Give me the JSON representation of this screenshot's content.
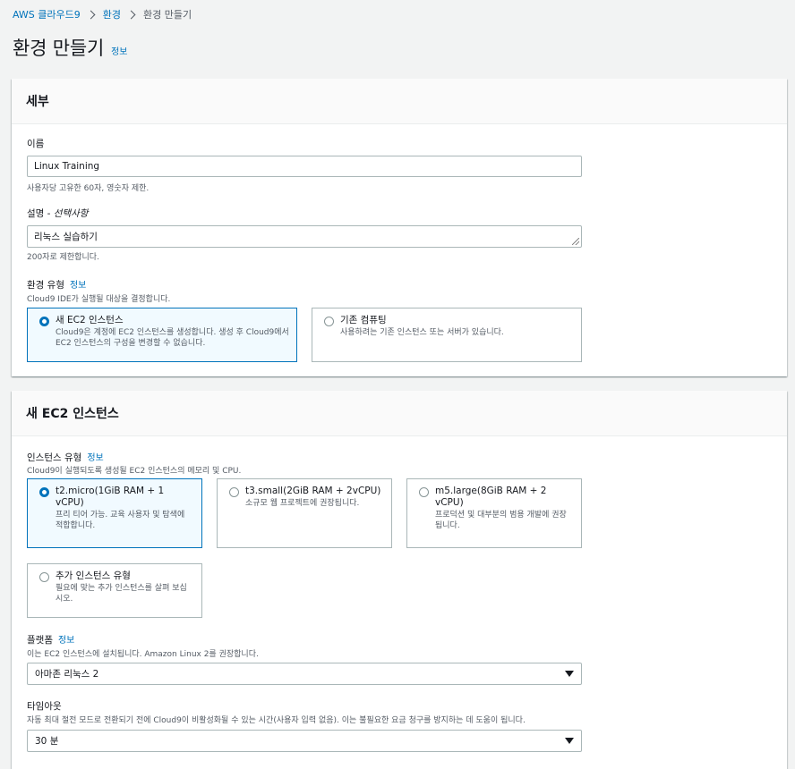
{
  "breadcrumb": {
    "items": [
      "AWS 클라우드9",
      "환경"
    ],
    "current": "환경 만들기"
  },
  "page": {
    "title": "환경 만들기",
    "info_link": "정보"
  },
  "details": {
    "header": "세부",
    "name": {
      "label": "이름",
      "value": "Linux Training",
      "hint": "사용자당 고유한 60자, 영숫자 제한."
    },
    "description": {
      "label": "설명 - ",
      "label_optional": "선택사항",
      "value": "리눅스 실습하기",
      "hint": "200자로 제한합니다."
    },
    "env_type": {
      "label": "환경 유형",
      "info_link": "정보",
      "hint": "Cloud9 IDE가 실행될 대상을 결정합니다.",
      "options": [
        {
          "title": "새 EC2 인스턴스",
          "desc": "Cloud9은 계정에 EC2 인스턴스를 생성합니다. 생성 후 Cloud9에서 EC2 인스턴스의 구성을 변경할 수 없습니다.",
          "selected": true
        },
        {
          "title": "기존 컴퓨팅",
          "desc": "사용하려는 기존 인스턴스 또는 서버가 있습니다.",
          "selected": false
        }
      ]
    }
  },
  "ec2": {
    "header": "새 EC2 인스턴스",
    "instance_type": {
      "label": "인스턴스 유형",
      "info_link": "정보",
      "hint": "Cloud9이 실행되도록 생성될 EC2 인스턴스의 메모리 및 CPU.",
      "options": [
        {
          "title": "t2.micro(1GiB RAM + 1 vCPU)",
          "desc": "프리 티어 가능. 교육 사용자 및 탐색에 적합합니다.",
          "selected": true
        },
        {
          "title": "t3.small(2GiB RAM + 2vCPU)",
          "desc": "소규모 웹 프로젝트에 권장됩니다.",
          "selected": false
        },
        {
          "title": "m5.large(8GiB RAM + 2 vCPU)",
          "desc": "프로덕션 및 대부분의 범용 개발에 권장됩니다.",
          "selected": false
        },
        {
          "title": "추가 인스턴스 유형",
          "desc": "필요에 맞는 추가 인스턴스를 살펴 보십시오.",
          "selected": false
        }
      ]
    },
    "platform": {
      "label": "플랫폼",
      "info_link": "정보",
      "hint": "이는 EC2 인스턴스에 설치됩니다. Amazon Linux 2를 권장합니다.",
      "value": "아마존 리눅스 2"
    },
    "timeout": {
      "label": "타임아웃",
      "hint": "자동 최대 절전 모드로 전환되기 전에 Cloud9이 비활성화될 수 있는 시간(사용자 입력 없음). 이는 불필요한 요금 청구를 방지하는 데 도움이 됩니다.",
      "value": "30 분"
    }
  },
  "colors": {
    "accent": "#0073bb",
    "selected_bg": "#f1faff",
    "page_bg": "#f2f3f3"
  }
}
